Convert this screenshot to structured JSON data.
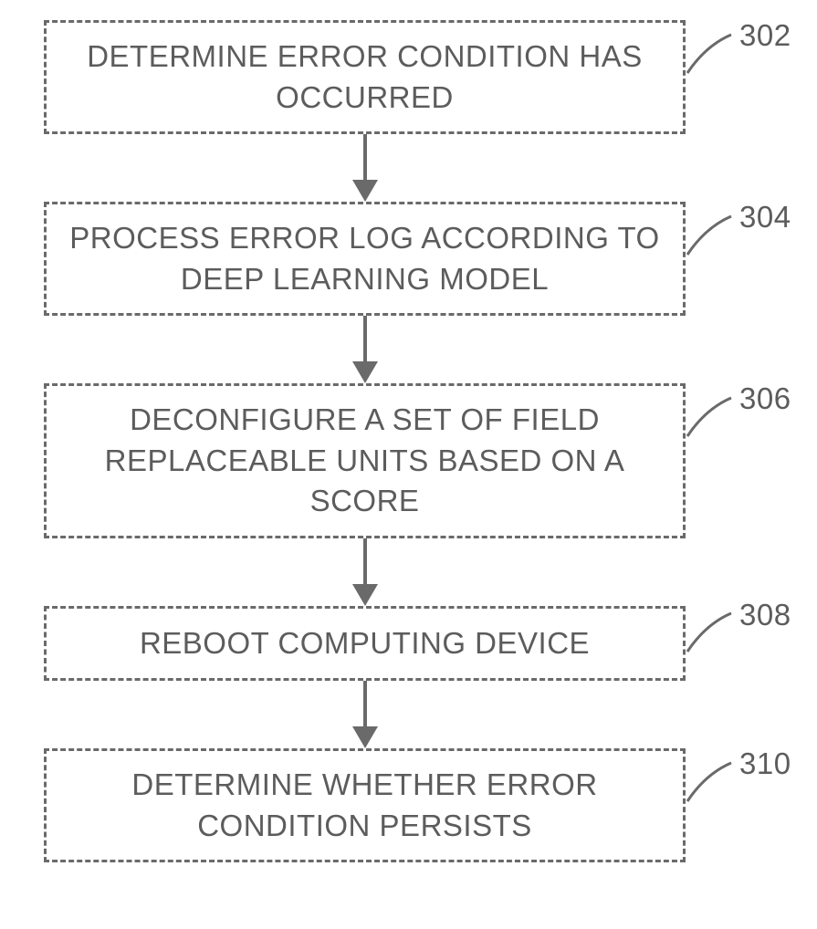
{
  "boxes": {
    "b1": {
      "text": "DETERMINE ERROR CONDITION HAS OCCURRED",
      "label": "302"
    },
    "b2": {
      "text": "PROCESS ERROR LOG ACCORDING TO DEEP LEARNING MODEL",
      "label": "304"
    },
    "b3": {
      "text": "DECONFIGURE A SET OF FIELD REPLACEABLE UNITS BASED ON A SCORE",
      "label": "306"
    },
    "b4": {
      "text": "REBOOT COMPUTING DEVICE",
      "label": "308"
    },
    "b5": {
      "text": "DETERMINE WHETHER ERROR CONDITION PERSISTS",
      "label": "310"
    }
  }
}
